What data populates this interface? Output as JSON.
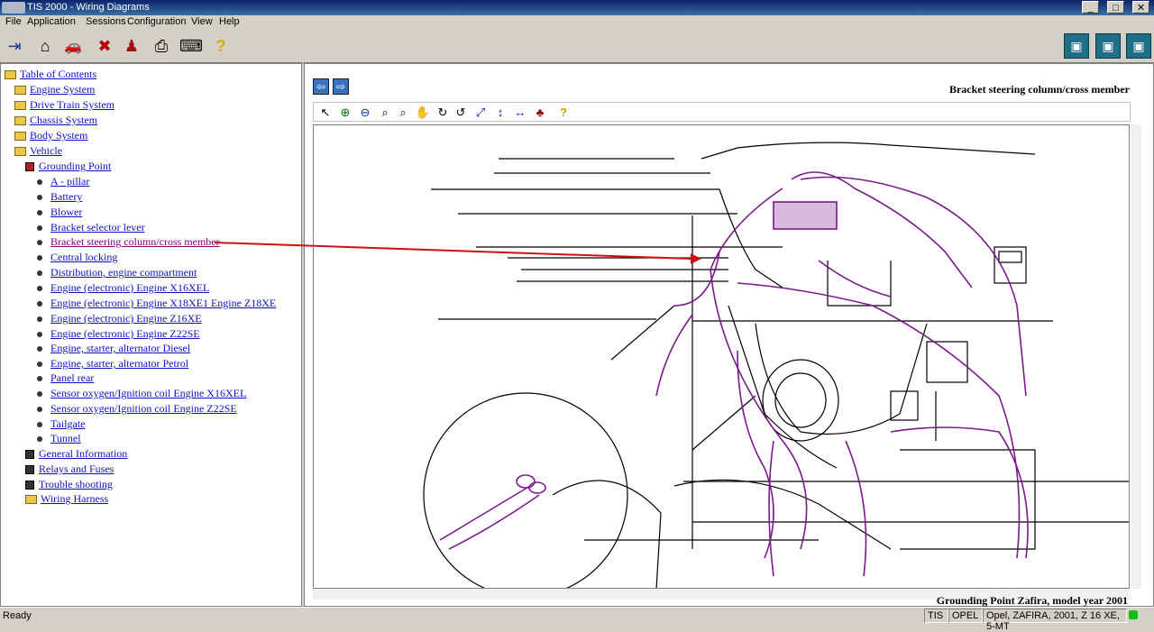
{
  "window": {
    "title": "TIS 2000 - Wiring Diagrams",
    "min": "_",
    "max": "□",
    "close": "✕"
  },
  "menu": [
    "File",
    "Application",
    "Sessions",
    "Configuration",
    "View",
    "Help"
  ],
  "toolbar_icons": [
    "exit-icon",
    "home-icon",
    "car-icon",
    "stop-icon",
    "person-icon",
    "print-icon",
    "keyboard-icon",
    "help-icon"
  ],
  "toolbar_right_icons": [
    "vehicle-icon-1",
    "vehicle-icon-2",
    "vehicle-icon-3"
  ],
  "tree": {
    "root": "Table of Contents",
    "level1a": [
      "Engine System",
      "Drive Train System",
      "Chassis System",
      "Body System"
    ],
    "vehicle": "Vehicle",
    "grounding": "Grounding Point",
    "grounding_items": [
      "A - pillar",
      "Battery",
      "Blower",
      "Bracket selector lever",
      "Bracket steering column/cross member",
      "Central locking",
      "Distribution, engine compartment",
      "Engine (electronic) Engine X16XEL",
      "Engine (electronic) Engine X18XE1 Engine Z18XE",
      "Engine (electronic) Engine Z16XE",
      "Engine (electronic) Engine Z22SE",
      "Engine, starter, alternator Diesel",
      "Engine, starter, alternator Petrol",
      "Panel rear",
      "Sensor oxygen/Ignition coil Engine X16XEL",
      "Sensor oxygen/Ignition coil Engine Z22SE",
      "Tailgate",
      "Tunnel"
    ],
    "level2b": [
      "General Information",
      "Relays and Fuses",
      "Trouble shooting"
    ],
    "wiring": "Wiring Harness"
  },
  "diagram": {
    "heading": "Bracket steering column/cross member",
    "footer": "Grounding Point Zafira, model year 2001"
  },
  "status": {
    "text": "Ready",
    "cells": [
      "TIS",
      "OPEL",
      "Opel, ZAFIRA, 2001, Z 16 XE, 5-MT"
    ]
  }
}
